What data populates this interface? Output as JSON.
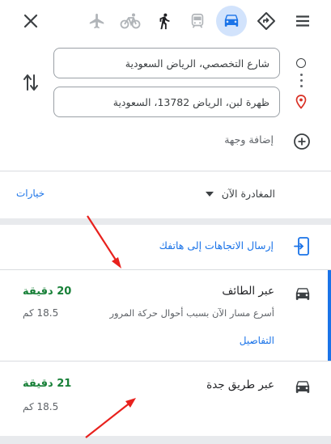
{
  "modes": [
    {
      "name": "flight",
      "active": false
    },
    {
      "name": "cycling",
      "active": false
    },
    {
      "name": "walking",
      "active": false
    },
    {
      "name": "transit",
      "active": false
    },
    {
      "name": "driving",
      "active": true
    },
    {
      "name": "best",
      "active": false
    }
  ],
  "origin": {
    "value": "شارع التخصصي، الرياض السعودية"
  },
  "destination": {
    "value": "ظهرة لبن، الرياض 13782، السعودية"
  },
  "add_destination": "إضافة وجهة",
  "depart": {
    "label": "المغادرة الآن"
  },
  "options_label": "خيارات",
  "send_to_phone": "إرسال الاتجاهات إلى هاتفك",
  "routes": [
    {
      "title": "عبر الطائف",
      "time": "20 دقيقة",
      "distance": "18.5 كم",
      "note": "أسرع مسار الآن بسبب أحوال حركة المرور",
      "details": "التفاصيل",
      "selected": true
    },
    {
      "title": "عبر طريق جدة",
      "time": "21 دقيقة",
      "distance": "18.5 كم",
      "selected": false
    }
  ],
  "colors": {
    "accent": "#1a73e8",
    "active_mode_bg": "#d2e3fc",
    "time_green": "#188038",
    "annotation_arrow": "#e8211d"
  }
}
